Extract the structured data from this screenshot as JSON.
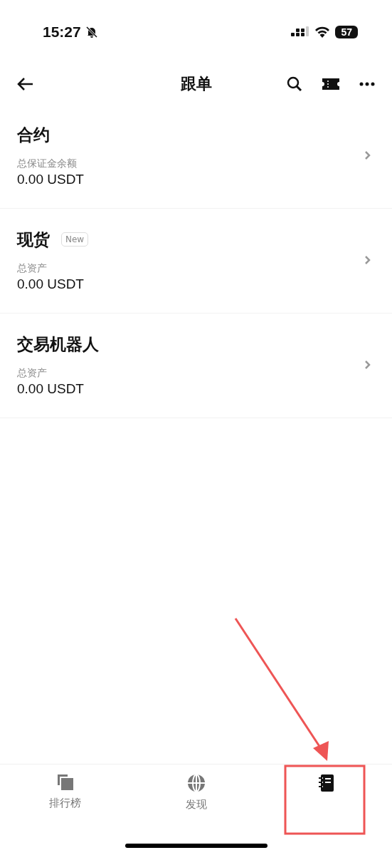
{
  "status_bar": {
    "time": "15:27",
    "silent": true,
    "battery": "57"
  },
  "header": {
    "title": "跟单"
  },
  "accounts": [
    {
      "title": "合约",
      "label": "总保证金余额",
      "value": "0.00 USDT"
    },
    {
      "title": "现货",
      "badge": "New",
      "label": "总资产",
      "value": "0.00 USDT"
    },
    {
      "title": "交易机器人",
      "label": "总资产",
      "value": "0.00 USDT"
    }
  ],
  "tab_bar": [
    {
      "kind": "ranking",
      "label": "排行榜",
      "selected": false
    },
    {
      "kind": "discover",
      "label": "发现",
      "selected": false
    },
    {
      "kind": "mine",
      "selected": true
    }
  ],
  "annotation": {
    "kind": "arrow-box"
  }
}
